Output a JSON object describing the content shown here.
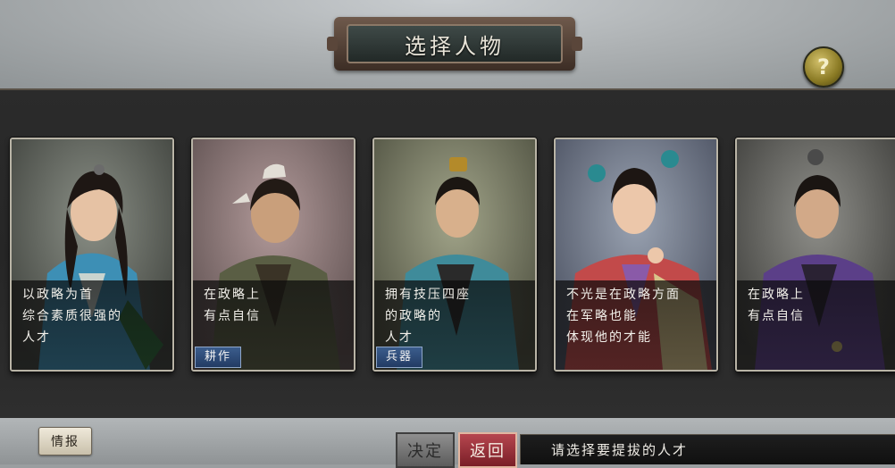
{
  "header": {
    "title": "选择人物"
  },
  "help": {
    "label": "?"
  },
  "cards": [
    {
      "lines": [
        "以政略为首",
        "综合素质很强的",
        "人才"
      ],
      "tag": ""
    },
    {
      "lines": [
        "在政略上",
        "有点自信"
      ],
      "tag": "耕作"
    },
    {
      "lines": [
        "拥有技压四座",
        "的政略的",
        "人才"
      ],
      "tag": "兵器"
    },
    {
      "lines": [
        "不光是在政略方面",
        "在军略也能",
        "体现他的才能"
      ],
      "tag": ""
    },
    {
      "lines": [
        "在政略上",
        "有点自信"
      ],
      "tag": ""
    }
  ],
  "footer": {
    "info_label": "情报",
    "confirm_label": "决定",
    "back_label": "返回",
    "status_text": "请选择要提拔的人才"
  }
}
